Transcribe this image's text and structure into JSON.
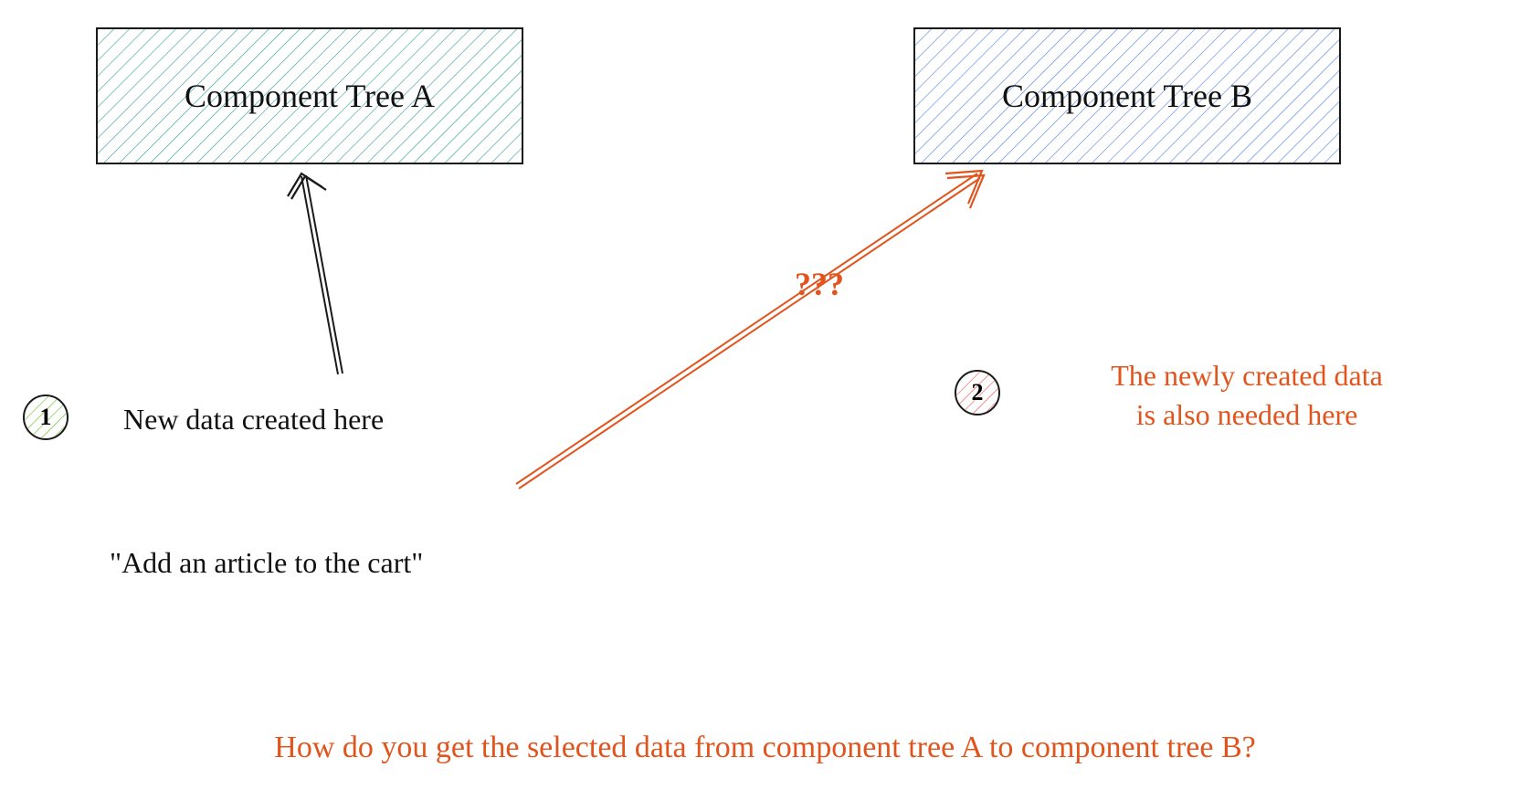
{
  "boxes": {
    "a": {
      "label": "Component Tree A",
      "hatch_color": "#2e9c94"
    },
    "b": {
      "label": "Component Tree B",
      "hatch_color": "#4f7fe0"
    }
  },
  "badges": {
    "one": {
      "num": "1",
      "fill": "#6ec22e"
    },
    "two": {
      "num": "2",
      "fill": "#f05a5a"
    }
  },
  "notes": {
    "created_here": "New data created here",
    "add_article": "\"Add an article to the cart\"",
    "needed_here_l1": "The newly created data",
    "needed_here_l2": "is also needed here",
    "question_marks": "???",
    "bottom_question": "How do you get the selected data from component tree A to component tree B?"
  },
  "colors": {
    "orange": "#e2541d",
    "black": "#1a1a1a"
  }
}
